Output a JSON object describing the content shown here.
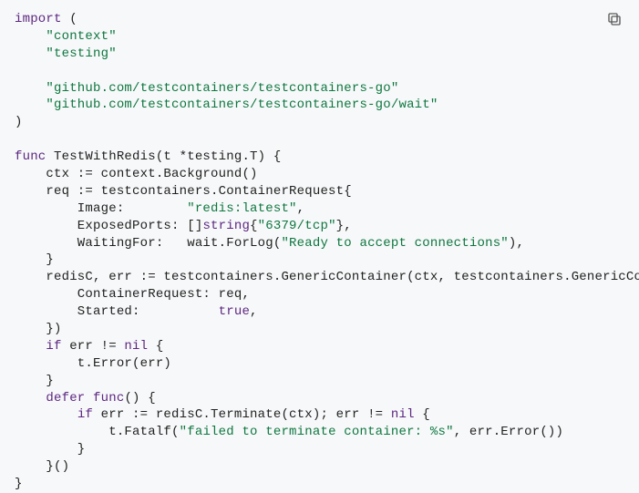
{
  "code": {
    "lines": [
      [
        {
          "cls": "kw",
          "t": "import"
        },
        {
          "cls": "pln",
          "t": " ("
        }
      ],
      [
        {
          "cls": "pln",
          "t": "    "
        },
        {
          "cls": "str",
          "t": "\"context\""
        }
      ],
      [
        {
          "cls": "pln",
          "t": "    "
        },
        {
          "cls": "str",
          "t": "\"testing\""
        }
      ],
      [
        {
          "cls": "pln",
          "t": ""
        }
      ],
      [
        {
          "cls": "pln",
          "t": "    "
        },
        {
          "cls": "str",
          "t": "\"github.com/testcontainers/testcontainers-go\""
        }
      ],
      [
        {
          "cls": "pln",
          "t": "    "
        },
        {
          "cls": "str",
          "t": "\"github.com/testcontainers/testcontainers-go/wait\""
        }
      ],
      [
        {
          "cls": "pln",
          "t": ")"
        }
      ],
      [
        {
          "cls": "pln",
          "t": ""
        }
      ],
      [
        {
          "cls": "kw",
          "t": "func"
        },
        {
          "cls": "pln",
          "t": " TestWithRedis(t *testing.T) {"
        }
      ],
      [
        {
          "cls": "pln",
          "t": "    ctx := context.Background()"
        }
      ],
      [
        {
          "cls": "pln",
          "t": "    req := testcontainers.ContainerRequest{"
        }
      ],
      [
        {
          "cls": "pln",
          "t": "        Image:        "
        },
        {
          "cls": "str",
          "t": "\"redis:latest\""
        },
        {
          "cls": "pln",
          "t": ","
        }
      ],
      [
        {
          "cls": "pln",
          "t": "        ExposedPorts: []"
        },
        {
          "cls": "typ",
          "t": "string"
        },
        {
          "cls": "pln",
          "t": "{"
        },
        {
          "cls": "str",
          "t": "\"6379/tcp\""
        },
        {
          "cls": "pln",
          "t": "},"
        }
      ],
      [
        {
          "cls": "pln",
          "t": "        WaitingFor:   wait.ForLog("
        },
        {
          "cls": "str",
          "t": "\"Ready to accept connections\""
        },
        {
          "cls": "pln",
          "t": "),"
        }
      ],
      [
        {
          "cls": "pln",
          "t": "    }"
        }
      ],
      [
        {
          "cls": "pln",
          "t": "    redisC, err := testcontainers.GenericContainer(ctx, testcontainers.GenericConta"
        }
      ],
      [
        {
          "cls": "pln",
          "t": "        ContainerRequest: req,"
        }
      ],
      [
        {
          "cls": "pln",
          "t": "        Started:          "
        },
        {
          "cls": "kw",
          "t": "true"
        },
        {
          "cls": "pln",
          "t": ","
        }
      ],
      [
        {
          "cls": "pln",
          "t": "    })"
        }
      ],
      [
        {
          "cls": "pln",
          "t": "    "
        },
        {
          "cls": "kw",
          "t": "if"
        },
        {
          "cls": "pln",
          "t": " err != "
        },
        {
          "cls": "kw",
          "t": "nil"
        },
        {
          "cls": "pln",
          "t": " {"
        }
      ],
      [
        {
          "cls": "pln",
          "t": "        t.Error(err)"
        }
      ],
      [
        {
          "cls": "pln",
          "t": "    }"
        }
      ],
      [
        {
          "cls": "pln",
          "t": "    "
        },
        {
          "cls": "kw",
          "t": "defer"
        },
        {
          "cls": "pln",
          "t": " "
        },
        {
          "cls": "kw",
          "t": "func"
        },
        {
          "cls": "pln",
          "t": "() {"
        }
      ],
      [
        {
          "cls": "pln",
          "t": "        "
        },
        {
          "cls": "kw",
          "t": "if"
        },
        {
          "cls": "pln",
          "t": " err := redisC.Terminate(ctx); err != "
        },
        {
          "cls": "kw",
          "t": "nil"
        },
        {
          "cls": "pln",
          "t": " {"
        }
      ],
      [
        {
          "cls": "pln",
          "t": "            t.Fatalf("
        },
        {
          "cls": "str",
          "t": "\"failed to terminate container: %s\""
        },
        {
          "cls": "pln",
          "t": ", err.Error())"
        }
      ],
      [
        {
          "cls": "pln",
          "t": "        }"
        }
      ],
      [
        {
          "cls": "pln",
          "t": "    }()"
        }
      ],
      [
        {
          "cls": "pln",
          "t": "}"
        }
      ]
    ]
  },
  "icons": {
    "copy": "copy-icon"
  }
}
